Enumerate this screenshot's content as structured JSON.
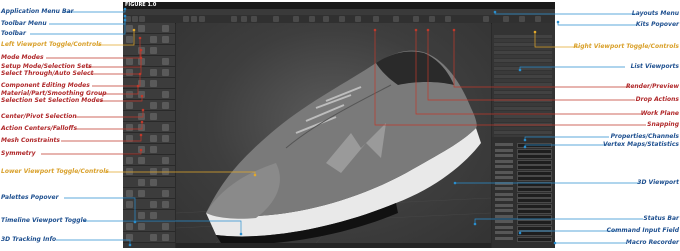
{
  "figure": {
    "title": "FIGURE 1.0",
    "colors": {
      "blue_label": "#1d4f8f",
      "orange_label": "#d9a02a",
      "red_label": "#b0282a",
      "blue_line": "#2a8fcf",
      "orange_line": "#e3a92b",
      "red_line": "#c0392b"
    }
  },
  "left_labels": [
    {
      "text": "Application Menu Bar",
      "color": "blue"
    },
    {
      "text": "Toolbar Menu",
      "color": "blue"
    },
    {
      "text": "Toolbar",
      "color": "blue"
    },
    {
      "text": "Left Viewport Toggle/Controls",
      "color": "orange"
    },
    {
      "text": "Mode Modes",
      "color": "red"
    },
    {
      "text": "Setup Mode/Selection Sets",
      "color": "red"
    },
    {
      "text": "Select Through/Auto Select",
      "color": "red"
    },
    {
      "text": "Component Editing Modes",
      "color": "red"
    },
    {
      "text": "Material/Part/Smoothing Group",
      "color": "red"
    },
    {
      "text": "Selection Set Selection Modes",
      "color": "red"
    },
    {
      "text": "Center/Pivot Selection",
      "color": "red"
    },
    {
      "text": "Action Centers/Falloffs",
      "color": "red"
    },
    {
      "text": "Mesh Constraints",
      "color": "red"
    },
    {
      "text": "Symmetry",
      "color": "red"
    },
    {
      "text": "Lower Viewport Toggle/Controls",
      "color": "orange"
    },
    {
      "text": "Palettes Popover",
      "color": "blue"
    },
    {
      "text": "Timeline Viewport Toggle",
      "color": "blue"
    },
    {
      "text": "3D Tracking Info",
      "color": "blue"
    }
  ],
  "right_labels": [
    {
      "text": "Layouts Menu",
      "color": "blue"
    },
    {
      "text": "Kits Popover",
      "color": "blue"
    },
    {
      "text": "Right Viewport Toggle/Controls",
      "color": "orange"
    },
    {
      "text": "List Viewports",
      "color": "blue"
    },
    {
      "text": "Render/Preview",
      "color": "red"
    },
    {
      "text": "Drop Actions",
      "color": "red"
    },
    {
      "text": "Work Plane",
      "color": "red"
    },
    {
      "text": "Snapping",
      "color": "red"
    },
    {
      "text": "Properties/Channels",
      "color": "blue"
    },
    {
      "text": "Vertex Maps/Statistics",
      "color": "blue"
    },
    {
      "text": "3D Viewport",
      "color": "blue"
    },
    {
      "text": "Status Bar",
      "color": "blue"
    },
    {
      "text": "Command Input Field",
      "color": "blue"
    },
    {
      "text": "Macro Recorder",
      "color": "blue"
    }
  ],
  "screenshot": {
    "viewport_subject": "sneaker-3d-model"
  }
}
